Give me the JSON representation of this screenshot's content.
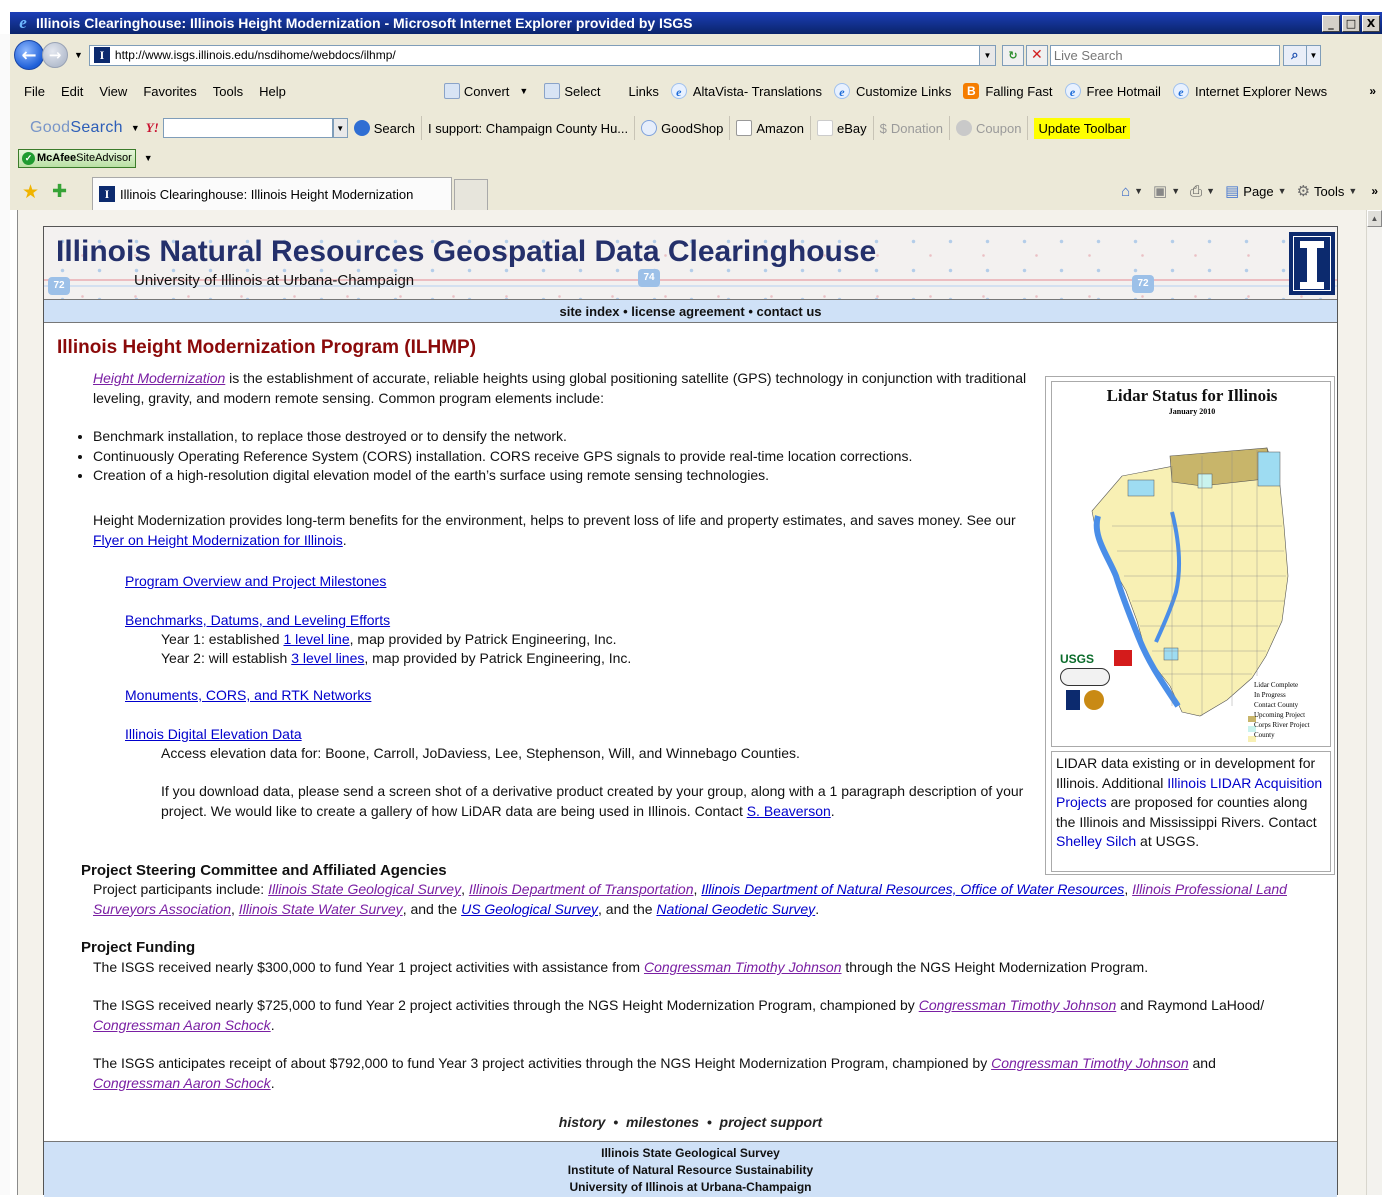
{
  "window": {
    "title": "Illinois Clearinghouse: Illinois Height Modernization - Microsoft Internet Explorer provided by ISGS",
    "min_btn": "_",
    "max_btn": "□",
    "close_btn": "X"
  },
  "address_bar": {
    "url": "http://www.isgs.illinois.edu/nsdihome/webdocs/ilhmp/",
    "live_search_placeholder": "Live Search"
  },
  "menu": {
    "items": [
      "File",
      "Edit",
      "View",
      "Favorites",
      "Tools",
      "Help"
    ],
    "convert": "Convert",
    "select": "Select",
    "links_label": "Links",
    "links": [
      "AltaVista- Translations",
      "Customize Links",
      "Falling Fast",
      "Free Hotmail",
      "Internet Explorer News"
    ]
  },
  "goodsearch_toolbar": {
    "logo_good": "Good",
    "logo_search": "Search",
    "yahoo": "Y!",
    "search_btn": "Search",
    "support": "I support: Champaign County Hu...",
    "goodshop": "GoodShop",
    "amazon": "Amazon",
    "ebay": "eBay",
    "donation": "Donation",
    "coupon": "Coupon",
    "update": "Update Toolbar"
  },
  "mcafee": {
    "brand": "McAfee",
    "product": "SiteAdvisor"
  },
  "tabs": {
    "active_tab": "Illinois Clearinghouse: Illinois Height Modernization",
    "page_btn": "Page",
    "tools_btn": "Tools"
  },
  "banner": {
    "title": "Illinois Natural Resources Geospatial Data Clearinghouse",
    "subtitle": "University of Illinois at Urbana-Champaign"
  },
  "site_nav": {
    "site_index": "site index",
    "license": "license agreement",
    "contact": "contact us",
    "sep": " • "
  },
  "main": {
    "heading": "Illinois Height Modernization Program (ILHMP)",
    "intro_link": "Height Modernization",
    "intro_text": " is the establishment of accurate, reliable heights using global positioning satellite (GPS) technology in conjunction with traditional leveling, gravity, and modern remote sensing. Common program elements include:",
    "bullets": [
      "Benchmark installation, to replace those destroyed or to densify the network.",
      "Continuously Operating Reference System (CORS) installation. CORS receive GPS signals to provide real-time location corrections.",
      "Creation of a high-resolution digital elevation model of the earth’s surface using remote sensing technologies."
    ],
    "benefits_text": "Height Modernization provides long-term benefits for the environment, helps to prevent loss of life and property estimates, and saves money. See our ",
    "flyer_link": "Flyer on Height Modernization for Illinois",
    "period": ".",
    "program_overview": "Program Overview and Project Milestones",
    "benchmarks_link": "Benchmarks, Datums, and Leveling Efforts",
    "year1_pre": "Year 1: established ",
    "year1_link": "1 level line",
    "year1_post": ", map provided by Patrick Engineering, Inc.",
    "year2_pre": "Year 2: will establish ",
    "year2_link": "3 level lines",
    "year2_post": ", map provided by Patrick Engineering, Inc.",
    "monuments_link": "Monuments, CORS, and RTK Networks",
    "dem_link": "Illinois Digital Elevation Data",
    "dem_access": "Access elevation data for: Boone, Carroll, JoDaviess, Lee, Stephenson, Will, and Winnebago Counties.",
    "dem_request": "If you download data, please send a screen shot of a derivative product created by your group, along with a 1 paragraph description of your project.  We would like to create a gallery of how LiDAR data are being used in Illinois. Contact ",
    "contact_link": "S. Beaverson",
    "steering_heading": "Project Steering Committee and Affiliated Agencies",
    "participants_pre": "Project participants include: ",
    "participants": [
      "Illinois State Geological Survey",
      "Illinois Department of Transportation",
      "Illinois Department of Natural Resources, Office of Water Resources",
      "Illinois Professional Land Surveyors Association",
      "Illinois State Water Survey",
      "US Geological Survey",
      "National Geodetic Survey"
    ],
    "funding_heading": "Project Funding",
    "funding1_pre": "The ISGS received nearly $300,000 to fund Year 1 project activities with assistance from ",
    "funding1_link": "Congressman Timothy Johnson",
    "funding1_post": " through the NGS Height Modernization Program.",
    "funding2_pre": "The ISGS received nearly $725,000 to fund Year 2 project activities through the NGS Height Modernization Program, championed by ",
    "funding2_link1": "Congressman Timothy Johnson",
    "funding2_mid": " and Raymond LaHood/ ",
    "funding2_link2": "Congressman Aaron Schock",
    "funding3_pre": "The ISGS anticipates receipt of about $792,000 to fund Year 3 project activities through the NGS Height Modernization Program, championed by ",
    "funding3_link1": "Congressman Timothy Johnson",
    "funding3_mid": " and ",
    "funding3_link2": "Congressman Aaron Schock"
  },
  "lidar": {
    "map_title": "Lidar Status for Illinois",
    "map_subtitle": "January 2010",
    "caption_pre": "LIDAR data existing or in development for Illinois. Additional ",
    "caption_link1": "Illinois LIDAR Acquisition Projects",
    "caption_mid": " are proposed for counties along the Illinois and Mississippi Rivers. Contact ",
    "caption_link2": "Shelley Silch",
    "caption_post": " at USGS.",
    "legend": [
      "Lidar Complete",
      "In Progress",
      "Contact County",
      "Upcoming Project",
      "Corps River Project",
      "County"
    ],
    "usgs": "USGS"
  },
  "bottom_nav": {
    "history": "history",
    "milestones": "milestones",
    "support": "project support"
  },
  "footer": {
    "line1": "Illinois State Geological Survey",
    "line2": "Institute of Natural Resource Sustainability",
    "line3": "University of Illinois at Urbana-Champaign"
  },
  "colors": {
    "heading": "#8b0a0a",
    "link": "#0000cc",
    "visited_link": "#7a1fa3",
    "nav_bg": "#cfe1f7",
    "banner_title": "#24306b"
  }
}
